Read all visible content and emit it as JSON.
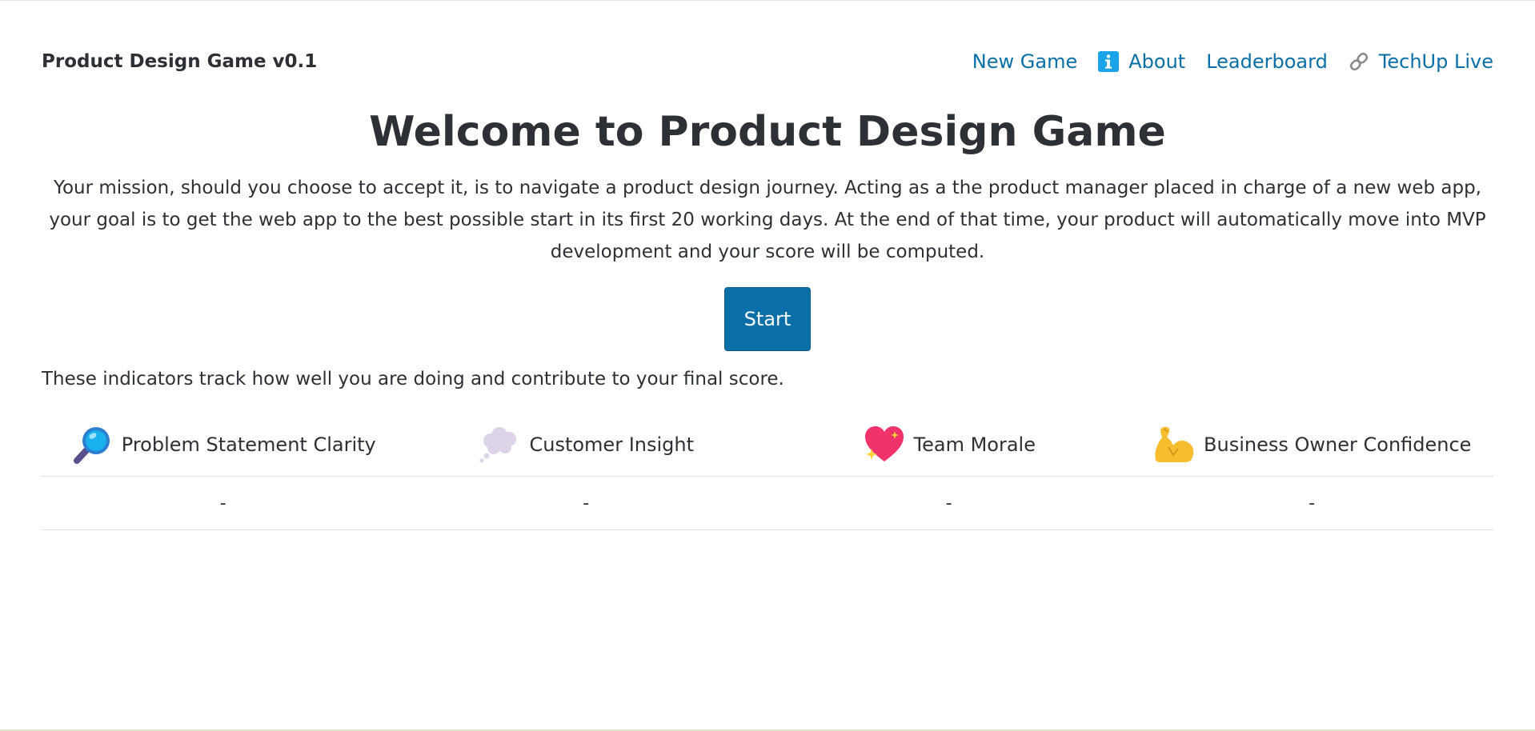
{
  "navbar": {
    "brand": "Product Design Game v0.1",
    "links": [
      {
        "label": "New Game",
        "icon": null
      },
      {
        "label": "About",
        "icon": "info-icon"
      },
      {
        "label": "Leaderboard",
        "icon": null
      },
      {
        "label": "TechUp Live",
        "icon": "link-icon"
      }
    ]
  },
  "main": {
    "title": "Welcome to Product Design Game",
    "mission": "Your mission, should you choose to accept it, is to navigate a product design journey. Acting as a the product manager placed in charge of a new web app, your goal is to get the web app to the best possible start in its first 20 working days. At the end of that time, your product will automatically move into MVP development and your score will be computed.",
    "start_label": "Start",
    "indicators_note": "These indicators track how well you are doing and contribute to your final score."
  },
  "indicators": {
    "headers": [
      {
        "label": "Problem Statement Clarity",
        "icon": "magnifying-glass-icon"
      },
      {
        "label": "Customer Insight",
        "icon": "thought-bubble-icon"
      },
      {
        "label": "Team Morale",
        "icon": "sparkling-heart-icon"
      },
      {
        "label": "Business Owner Confidence",
        "icon": "flexed-biceps-icon"
      }
    ],
    "values": [
      "-",
      "-",
      "-",
      "-"
    ]
  },
  "colors": {
    "link": "#0a6fa8",
    "button": "#0a6fa8",
    "text": "#2d3034",
    "info_icon": "#1aa3e8"
  }
}
